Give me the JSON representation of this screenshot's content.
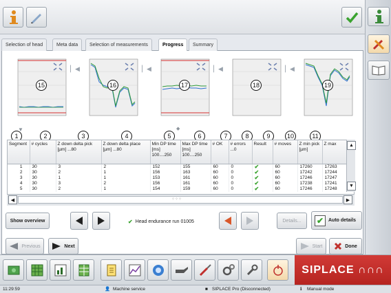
{
  "tabs": [
    {
      "label": "Selection of head",
      "active": false
    },
    {
      "label": "Meta data",
      "active": false
    },
    {
      "label": "Selection of measurements",
      "active": false
    },
    {
      "label": "Progress",
      "active": true
    },
    {
      "label": "Summary",
      "active": false
    }
  ],
  "graphs": [
    {
      "callout": "15"
    },
    {
      "callout": "16"
    },
    {
      "callout": "17"
    },
    {
      "callout": "18"
    },
    {
      "callout": "19"
    }
  ],
  "callouts": [
    "1",
    "2",
    "3",
    "4",
    "5",
    "6",
    "7",
    "8",
    "9",
    "10",
    "11"
  ],
  "table": {
    "columns": [
      "Segment",
      "# cycles",
      "Z down delta pick [µm] ...80",
      "Z down delta place [µm] ...80",
      "Min DP time [ms] 100....250",
      "Max DP time [ms] 100....250",
      "# OK",
      "# errors ...0",
      "Result",
      "# moves",
      "Z min pick [µm]",
      "Z max"
    ],
    "rows": [
      [
        "1",
        "30",
        "3",
        "2",
        "152",
        "155",
        "60",
        "0",
        "✔",
        "60",
        "17260",
        "17263"
      ],
      [
        "2",
        "30",
        "2",
        "1",
        "156",
        "163",
        "60",
        "0",
        "✔",
        "60",
        "17242",
        "17244"
      ],
      [
        "3",
        "30",
        "1",
        "1",
        "153",
        "161",
        "60",
        "0",
        "✔",
        "60",
        "17246",
        "17247"
      ],
      [
        "4",
        "30",
        "3",
        "2",
        "156",
        "161",
        "60",
        "0",
        "✔",
        "60",
        "17238",
        "17241"
      ],
      [
        "5",
        "30",
        "2",
        "1",
        "154",
        "159",
        "60",
        "0",
        "✔",
        "60",
        "17246",
        "17248"
      ]
    ]
  },
  "controls": {
    "show_overview": "Show overview",
    "status_message": "Head endurance run 01005",
    "details": "Details...",
    "auto_details": "Auto details",
    "auto_details_checked": true
  },
  "wizard": {
    "previous": "Previous",
    "next": "Next",
    "start": "Start",
    "done": "Done"
  },
  "brand": "SIPLACE ∩∩∩",
  "status_bar": {
    "time": "11:29:59",
    "role": "Machine service",
    "connection": "SIPLACE Pro (Disconnected)",
    "mode": "Manual mode"
  },
  "colors": {
    "brand_red": "#c0302c",
    "accent_green": "#3aa32f",
    "line_blue": "#2e6fd1",
    "line_green": "#2e9a3a",
    "limit_red": "#d62d2d"
  }
}
